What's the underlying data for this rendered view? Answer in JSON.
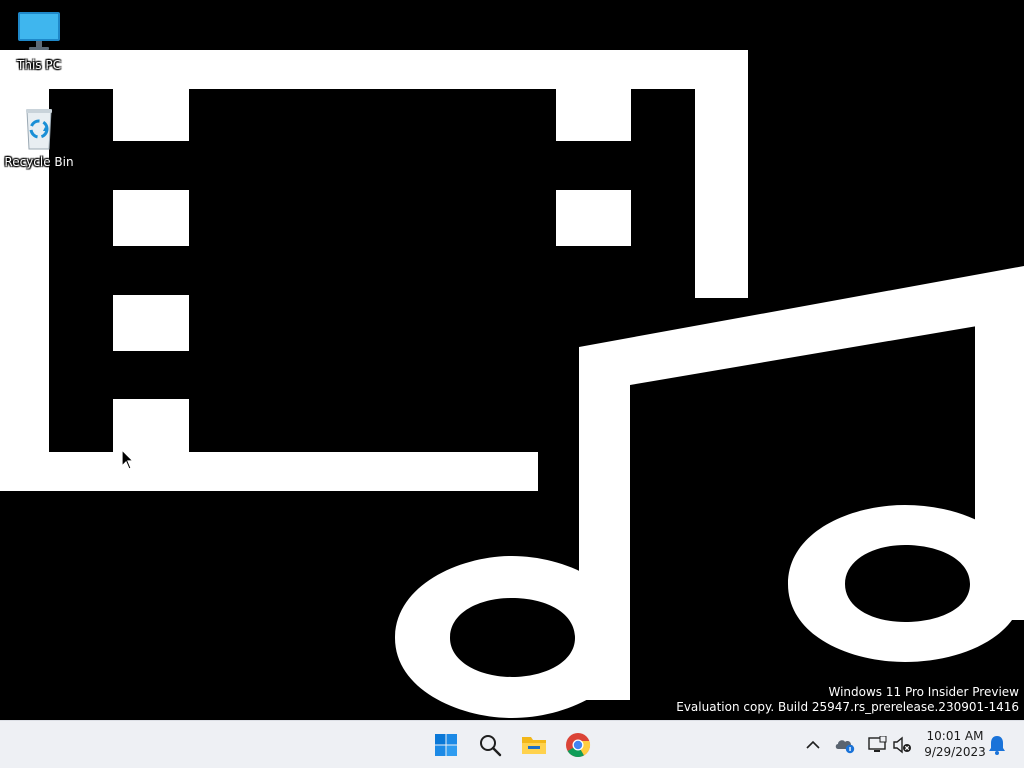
{
  "desktop": {
    "icons": [
      {
        "label": "This PC",
        "icon": "computer-monitor-icon"
      },
      {
        "label": "Recycle Bin",
        "icon": "recycle-bin-icon"
      }
    ],
    "wallpaper": "film-and-music-glyph",
    "watermark": {
      "line1": "Windows 11 Pro Insider Preview",
      "line2": "Evaluation copy. Build 25947.rs_prerelease.230901-1416"
    }
  },
  "taskbar": {
    "apps": [
      {
        "name": "Start",
        "icon": "windows-start-icon"
      },
      {
        "name": "Search",
        "icon": "search-icon"
      },
      {
        "name": "File Explorer",
        "icon": "folder-icon"
      },
      {
        "name": "Google Chrome",
        "icon": "chrome-icon"
      }
    ],
    "tray": {
      "icons": [
        "chevron-up-icon",
        "onedrive-icon",
        "network-icon",
        "volume-muted-icon"
      ],
      "time": "10:01 AM",
      "date": "9/29/2023",
      "notification_icon": "bell-icon"
    }
  },
  "colors": {
    "accent": "#0078d4",
    "taskbar_bg": "#eef0f4",
    "wallpaper_bg": "#000000",
    "wallpaper_fg": "#ffffff"
  }
}
